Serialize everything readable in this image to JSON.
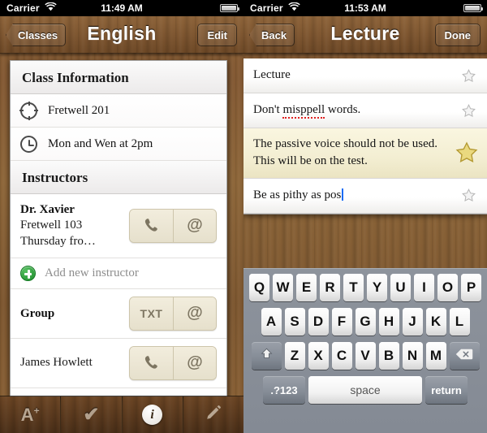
{
  "left_screen": {
    "status_bar": {
      "carrier": "Carrier",
      "wifi_icon": "wifi-icon",
      "time": "11:49 AM",
      "battery_icon": "battery-icon"
    },
    "nav": {
      "back_label": "Classes",
      "title": "English",
      "action_label": "Edit"
    },
    "sections": [
      {
        "header": "Class Information",
        "rows": [
          {
            "icon": "compass-icon",
            "text": "Fretwell 201"
          },
          {
            "icon": "clock-icon",
            "text": "Mon and Wen at 2pm"
          }
        ]
      },
      {
        "header": "Instructors",
        "instructor": {
          "name": "Dr. Xavier",
          "location": "Fretwell 103",
          "hours": "Thursday fro…",
          "buttons": [
            {
              "icon": "phone-icon",
              "label": "✆"
            },
            {
              "icon": "email-icon",
              "label": "@"
            }
          ]
        },
        "add_row": {
          "icon": "plus-circle-icon",
          "label": "Add new instructor"
        }
      }
    ],
    "group_row": {
      "label": "Group",
      "buttons": [
        {
          "icon": "text-message-icon",
          "label": "TXT"
        },
        {
          "icon": "email-icon",
          "label": "@"
        }
      ]
    },
    "contact_row": {
      "label": "James Howlett",
      "buttons": [
        {
          "icon": "phone-icon",
          "label": "✆"
        },
        {
          "icon": "email-icon",
          "label": "@"
        }
      ]
    },
    "tabs": [
      {
        "name": "grades",
        "icon": "a-plus-icon",
        "glyph": "A",
        "sup": "+",
        "active": false
      },
      {
        "name": "tasks",
        "icon": "checkmark-icon",
        "glyph": "✔",
        "active": false
      },
      {
        "name": "info",
        "icon": "info-circle-icon",
        "glyph": "i",
        "active": true
      },
      {
        "name": "notes",
        "icon": "pencil-icon",
        "glyph": "✎",
        "active": false
      }
    ]
  },
  "right_screen": {
    "status_bar": {
      "carrier": "Carrier",
      "wifi_icon": "wifi-icon",
      "time": "11:53 AM",
      "battery_icon": "battery-icon"
    },
    "nav": {
      "back_label": "Back",
      "title": "Lecture",
      "action_label": "Done"
    },
    "notes": [
      {
        "text": "Lecture",
        "starred": false,
        "editing": false
      },
      {
        "text_before": "Don't ",
        "misspelled": "misppell",
        "text_after": " words.",
        "starred": false,
        "editing": false
      },
      {
        "text": "The passive voice should not be used. This will be on the test.",
        "starred": true,
        "editing": false
      },
      {
        "text": "Be as pithy as pos",
        "starred": false,
        "editing": true
      }
    ],
    "keyboard": {
      "row1": [
        "Q",
        "W",
        "E",
        "R",
        "T",
        "Y",
        "U",
        "I",
        "O",
        "P"
      ],
      "row2": [
        "A",
        "S",
        "D",
        "F",
        "G",
        "H",
        "J",
        "K",
        "L"
      ],
      "row3": [
        "Z",
        "X",
        "C",
        "V",
        "B",
        "N",
        "M"
      ],
      "shift_icon": "shift-icon",
      "shift_glyph": "⇧",
      "backspace_icon": "backspace-icon",
      "backspace_glyph": "⌫",
      "numbers_label": ".?123",
      "space_label": "space",
      "return_label": "return"
    }
  },
  "colors": {
    "wood": "#835933",
    "star_filled": "#e8d27a",
    "spellcheck_underline": "#e02020",
    "caret": "#1a6cf5",
    "add_green": "#1d8c2c",
    "contact_button": "#ede8d6"
  }
}
